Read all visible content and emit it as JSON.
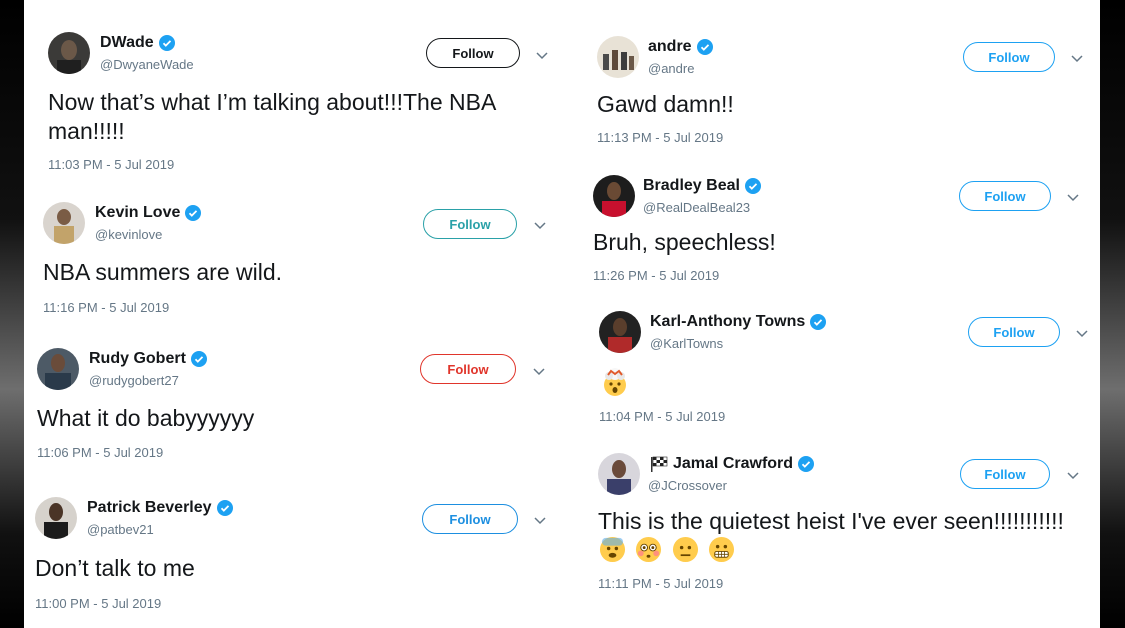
{
  "follow_label": "Follow",
  "tweets": [
    {
      "name": "DWade",
      "handle": "@DwyaneWade",
      "text": "Now that’s what I’m talking about!!!The NBA",
      "text2": "man!!!!!",
      "time": "11:03 PM - 5 Jul 2019",
      "follow_color": "#14171a"
    },
    {
      "name": "Kevin Love",
      "handle": "@kevinlove",
      "text": "NBA summers are wild.",
      "time": "11:16 PM - 5 Jul 2019",
      "follow_color": "#2aa1a8"
    },
    {
      "name": "Rudy Gobert",
      "handle": "@rudygobert27",
      "text": "What it do babyyyyyy",
      "time": "11:06 PM - 5 Jul 2019",
      "follow_color": "#e0352b"
    },
    {
      "name": "Patrick Beverley",
      "handle": "@patbev21",
      "text": "Don’t talk to me",
      "time": "11:00 PM - 5 Jul 2019",
      "follow_color": "#1d8fe0"
    },
    {
      "name": "andre",
      "handle": "@andre",
      "text": "Gawd damn!!",
      "time": "11:13 PM - 5 Jul 2019",
      "follow_color": "#1da1f2"
    },
    {
      "name": "Bradley Beal",
      "handle": "@RealDealBeal23",
      "text": "Bruh, speechless!",
      "time": "11:26 PM - 5 Jul 2019",
      "follow_color": "#1da1f2"
    },
    {
      "name": "Karl-Anthony Towns",
      "handle": "@KarlTowns",
      "text": "",
      "time": "11:04 PM - 5 Jul 2019",
      "follow_color": "#1da1f2"
    },
    {
      "name": "Jamal Crawford",
      "name_prefix_icon": "checkered-flag",
      "handle": "@JCrossover",
      "text": "This is the quietest heist I've ever seen!!!!!!!!!!!",
      "time": "11:11 PM - 5 Jul 2019",
      "follow_color": "#1da1f2"
    }
  ],
  "colors": {
    "accent": "#1da1f2",
    "text": "#14171a",
    "muted": "#657786"
  }
}
